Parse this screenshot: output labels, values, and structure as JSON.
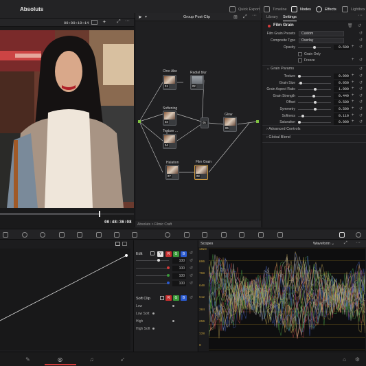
{
  "project": "Absoluts",
  "topnav": {
    "quick_export": "Quick Export",
    "timeline": "Timeline",
    "nodes": "Nodes",
    "effects": "Effects",
    "lightbox": "Lightbox"
  },
  "viewer": {
    "timecode": "00:00:19:14",
    "end_timecode": "00:48:36:08",
    "progress": 0.74
  },
  "nodes": {
    "title": "Group Post-Clip",
    "breadcrumb": "Absoluts  >  Filmic Craft",
    "list": [
      {
        "label": "Chro Abe",
        "num": "01"
      },
      {
        "label": "Radial blur",
        "num": "02"
      },
      {
        "label": "Softening",
        "num": "03"
      },
      {
        "label": "Texture ...",
        "num": "04"
      },
      {
        "label": "",
        "num": "05"
      },
      {
        "label": "Glow",
        "num": "06"
      },
      {
        "label": "Halation",
        "num": "07"
      },
      {
        "label": "Film Grain",
        "num": "08"
      }
    ]
  },
  "inspector": {
    "tabs": [
      "Library",
      "Settings"
    ],
    "effect": "Film Grain",
    "presets_label": "Film Grain Presets",
    "presets_value": "Custom",
    "composite_label": "Composite Type",
    "composite_value": "Overlay",
    "opacity_label": "Opacity",
    "opacity_value": "0.500",
    "grain_only": "Grain Only",
    "freeze": "Freeze",
    "grain_params": "Grain Params",
    "params": [
      {
        "label": "Texture",
        "value": "0.000",
        "pos": 0.0
      },
      {
        "label": "Grain Size",
        "value": "0.050",
        "pos": 0.05
      },
      {
        "label": "Grain Aspect Ratio",
        "value": "1.000",
        "pos": 0.5
      },
      {
        "label": "Grain Strength",
        "value": "0.449",
        "pos": 0.45
      },
      {
        "label": "Offset",
        "value": "0.500",
        "pos": 0.5
      },
      {
        "label": "Symmetry",
        "value": "0.500",
        "pos": 0.5
      },
      {
        "label": "Softness",
        "value": "0.110",
        "pos": 0.11
      },
      {
        "label": "Saturation",
        "value": "0.000",
        "pos": 0.0
      }
    ],
    "advanced": "Advanced Controls",
    "global_blend": "Global Blend"
  },
  "edit": {
    "title": "Edit",
    "values": [
      "100",
      "100",
      "100",
      "100"
    ],
    "soft_clip": "Soft Clip",
    "soft_rows": [
      "Low",
      "Low Soft",
      "High",
      "High Soft"
    ]
  },
  "scopes": {
    "title": "Scopes",
    "mode": "Waveform",
    "ticks": [
      "1023",
      "896",
      "768",
      "640",
      "512",
      "384",
      "256",
      "128",
      "0"
    ]
  },
  "colors": {
    "accent_red": "#d23b3b",
    "node_green": "#7fc241"
  }
}
